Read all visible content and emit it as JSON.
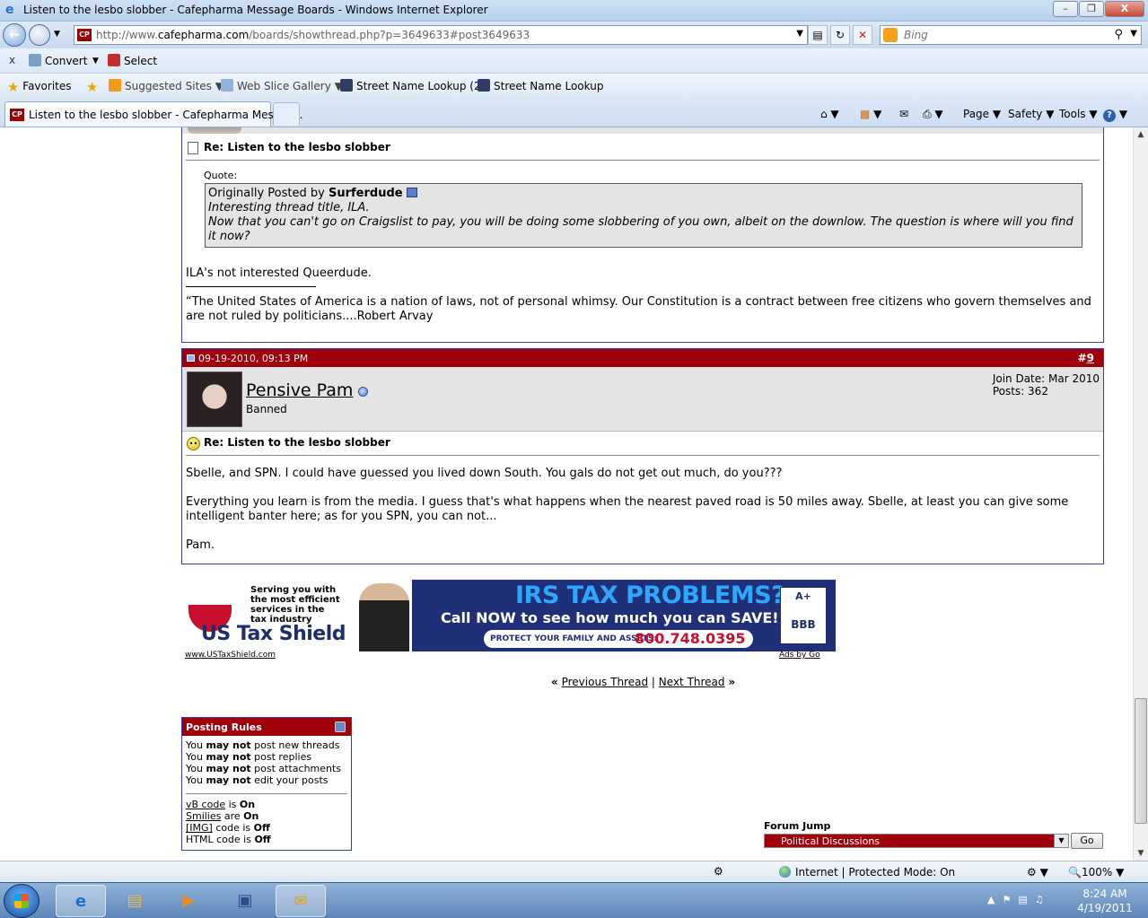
{
  "window": {
    "title": "Listen to the lesbo slobber - Cafepharma Message Boards - Windows Internet Explorer",
    "min": "–",
    "max": "❐",
    "close": "X"
  },
  "nav": {
    "url_prefix": "http://www.",
    "url_domain": "cafepharma.com",
    "url_rest": "/boards/showthread.php?p=3649633#post3649633",
    "favicon_text": "CP",
    "search_placeholder": "Bing"
  },
  "command_bar": {
    "close": "x",
    "convert": "Convert",
    "select": "Select"
  },
  "favorites_bar": {
    "favorites": "Favorites",
    "suggested": "Suggested Sites",
    "webslice": "Web Slice Gallery",
    "street1": "Street Name Lookup (2)",
    "street2": "Street Name Lookup"
  },
  "tab": {
    "label": "Listen to the lesbo slobber - Cafepharma Messag...",
    "favicon_text": "CP"
  },
  "toolbar": {
    "page": "Page",
    "safety": "Safety",
    "tools": "Tools",
    "help": "?"
  },
  "post1": {
    "title": "Re: Listen to the lesbo slobber",
    "quote_label": "Quote:",
    "quote_prefix": "Originally Posted by",
    "quote_author": "Surferdude",
    "quote_line1": "Interesting thread title, ILA.",
    "quote_line2": "Now that you can't go on Craigslist to pay, you will be doing some slobbering of you own, albeit on the downlow. The question is where will you find it now?",
    "body": "ILA's not interested Queerdude.",
    "signature": "“The United States of America is a nation of laws, not of personal whimsy. Our Constitution is a contract between free citizens who govern themselves and are not ruled by politicians....Robert Arvay"
  },
  "post2": {
    "date": "09-19-2010, 09:13 PM",
    "number_prefix": "#",
    "number": "9",
    "username": "Pensive Pam",
    "user_title": "Banned",
    "join_date": "Join Date: Mar 2010",
    "posts": "Posts: 362",
    "title": "Re: Listen to the lesbo slobber",
    "para1": "Sbelle, and SPN. I could have guessed you lived down South. You gals do not get out much, do you???",
    "para2": "Everything you learn is from the media. I guess that's what happens when the nearest paved road is 50 miles away. Sbelle, at least you can give some intelligent banter here; as for you SPN, you can not...",
    "para3": "Pam."
  },
  "ad": {
    "tagline1": "Serving you with",
    "tagline2": "the most efficient",
    "tagline3": "services in the",
    "tagline4": "tax industry",
    "brand_us": "US",
    "brand_name": "Tax Shield",
    "headline": "IRS TAX PROBLEMS?",
    "subline": "Call NOW to see how much you can SAVE!",
    "protect": "PROTECT YOUR FAMILY AND ASSETS:",
    "phone": "800.748.0395",
    "bbb": "BBB",
    "bbb_grade": "A+",
    "url": "www.USTaxShield.com",
    "ads_by": "Ads by Go"
  },
  "thread_nav": {
    "open": "«",
    "prev": "Previous Thread",
    "sep": "|",
    "next": "Next Thread",
    "close": "»"
  },
  "posting_rules": {
    "title": "Posting Rules",
    "you": "You",
    "may_not": "may not",
    "r1": "post new threads",
    "r2": "post replies",
    "r3": "post attachments",
    "r4": "edit your posts",
    "vb_code": "vB code",
    "is": "is",
    "are": "are",
    "on": "On",
    "off": "Off",
    "smilies": "Smilies",
    "img": "[IMG]",
    "code_is": "code is",
    "html_code": "HTML code"
  },
  "forum_jump": {
    "label": "Forum Jump",
    "selected": "Political Discussions",
    "go": "Go"
  },
  "status": {
    "zone": "Internet | Protected Mode: On",
    "zoom": "100%"
  },
  "taskbar": {
    "time": "8:24 AM",
    "date": "4/19/2011"
  }
}
